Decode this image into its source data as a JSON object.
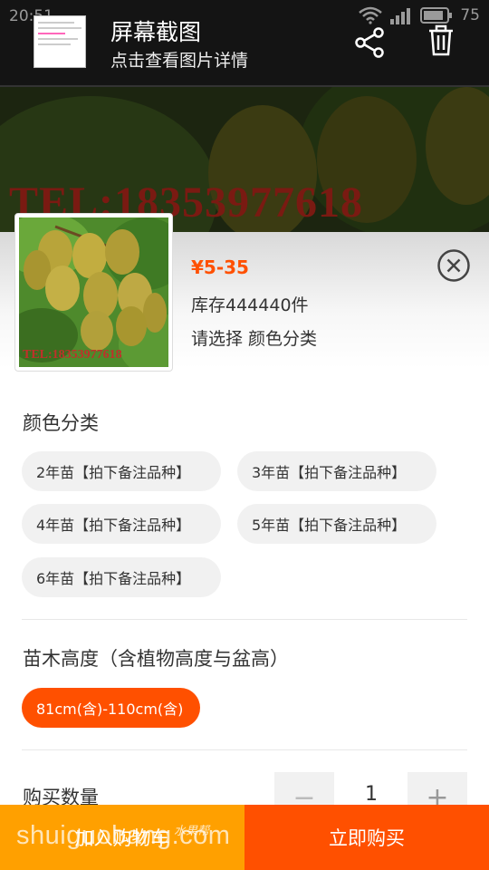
{
  "status_bar": {
    "time": "20:51",
    "battery": "75"
  },
  "viewer": {
    "title": "屏幕截图",
    "subtitle": "点击查看图片详情",
    "icons": {
      "share": "share-icon",
      "delete": "trash-icon"
    }
  },
  "background": {
    "watermark": "TEL:18353977618"
  },
  "product": {
    "price": "¥5-35",
    "stock": "库存444440件",
    "select_hint": "请选择 颜色分类",
    "image_watermark": "TEL:18353977618",
    "close_icon": "close-circle-icon"
  },
  "color_section": {
    "title": "颜色分类",
    "options": [
      "2年苗【拍下备注品种】",
      "3年苗【拍下备注品种】",
      "4年苗【拍下备注品种】",
      "5年苗【拍下备注品种】",
      "6年苗【拍下备注品种】"
    ]
  },
  "height_section": {
    "title": "苗木高度（含植物高度与盆高）",
    "options": [
      "81cm(含)-110cm(含)"
    ],
    "selected": "81cm(含)-110cm(含)"
  },
  "quantity": {
    "label": "购买数量",
    "value": "1",
    "minus": "−",
    "plus": "+"
  },
  "actions": {
    "add_to_cart": "加入购物车",
    "buy_now": "立即购买"
  },
  "overlay_watermark": {
    "site": "shuiguobang.com",
    "site_cn": "水果帮"
  },
  "colors": {
    "accent": "#ff5000",
    "cart": "#ffa000",
    "chip_bg": "#f1f1f1"
  }
}
